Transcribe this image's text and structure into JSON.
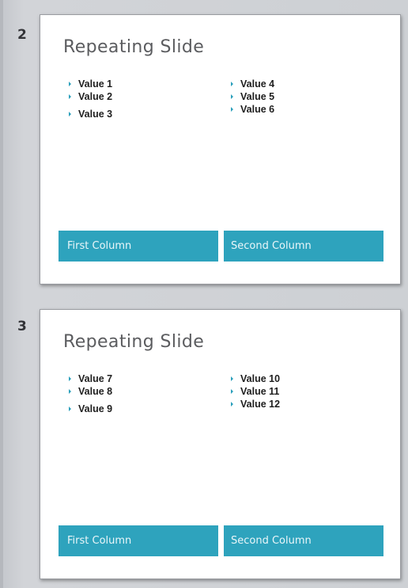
{
  "slides": [
    {
      "number": "2",
      "title": "Repeating Slide",
      "left_values": [
        "Value 1",
        "Value 2",
        "Value 3"
      ],
      "right_values": [
        "Value 4",
        "Value 5",
        "Value 6"
      ],
      "footer": {
        "first": "First Column",
        "second": "Second Column"
      }
    },
    {
      "number": "3",
      "title": "Repeating Slide",
      "left_values": [
        "Value 7",
        "Value 8",
        "Value 9"
      ],
      "right_values": [
        "Value 10",
        "Value 11",
        "Value 12"
      ],
      "footer": {
        "first": "First Column",
        "second": "Second Column"
      }
    }
  ],
  "colors": {
    "accent": "#2ea3bd",
    "slide_background": "#ffffff",
    "pane_background": "#cdd0d4"
  }
}
